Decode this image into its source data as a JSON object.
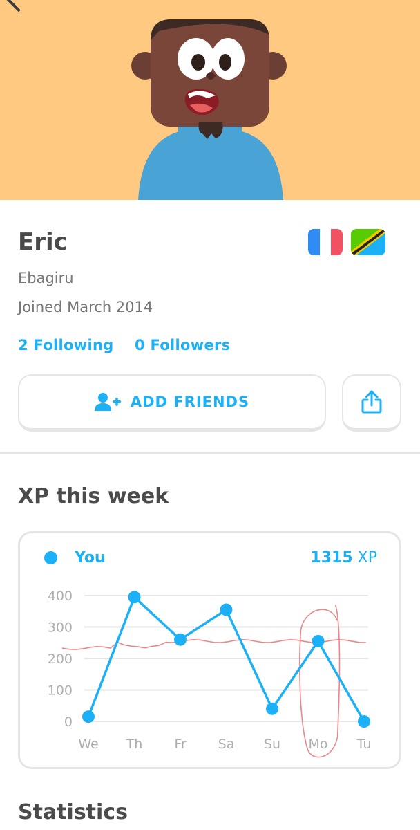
{
  "profile": {
    "name": "Eric",
    "username": "Ebagiru",
    "joined": "Joined March 2014",
    "following": "2 Following",
    "followers": "0 Followers",
    "flags": [
      "france-flag",
      "tanzania-flag"
    ]
  },
  "actions": {
    "add_friends": "ADD FRIENDS",
    "share_icon": "share-icon",
    "add_friend_icon": "add-person-icon"
  },
  "xp_section": {
    "title": "XP this week",
    "legend_label": "You",
    "total_value": "1315",
    "total_unit": "XP"
  },
  "statistics": {
    "title": "Statistics"
  },
  "colors": {
    "accent": "#1cb0f6",
    "hero_bg": "#ffc982",
    "border": "#e5e5e5",
    "annotation": "#e57373"
  },
  "chart_data": {
    "type": "line",
    "categories": [
      "We",
      "Th",
      "Fr",
      "Sa",
      "Su",
      "Mo",
      "Tu"
    ],
    "series": [
      {
        "name": "You",
        "values": [
          15,
          395,
          260,
          355,
          40,
          255,
          0
        ]
      }
    ],
    "y_ticks": [
      0,
      100,
      200,
      300,
      400
    ],
    "ylim": [
      0,
      400
    ],
    "grid": true,
    "annotation_line_value": 255
  }
}
